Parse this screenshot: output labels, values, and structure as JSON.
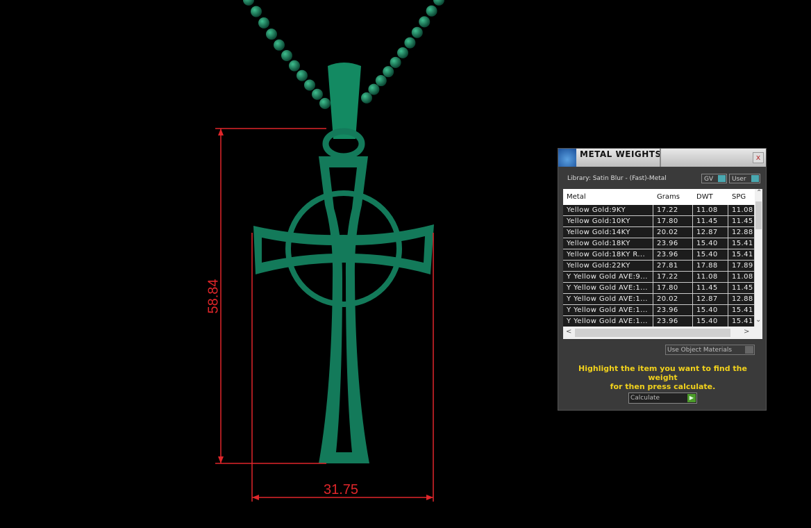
{
  "dimensions": {
    "height": "58.84",
    "width": "31.75"
  },
  "panel": {
    "title": "METAL WEIGHTS",
    "close_label": "x",
    "library": "Library: Satin Blur - (Fast)-Metal",
    "toggle_gv": "GV",
    "toggle_user": "User",
    "columns": [
      "Metal",
      "Grams",
      "DWT",
      "SPG"
    ],
    "rows": [
      [
        "Yellow Gold:9KY",
        "17.22",
        "11.08",
        "11.08"
      ],
      [
        "Yellow Gold:10KY",
        "17.80",
        "11.45",
        "11.45"
      ],
      [
        "Yellow Gold:14KY",
        "20.02",
        "12.87",
        "12.88"
      ],
      [
        "Yellow Gold:18KY",
        "23.96",
        "15.40",
        "15.41"
      ],
      [
        "Yellow Gold:18KY R...",
        "23.96",
        "15.40",
        "15.41"
      ],
      [
        "Yellow Gold:22KY",
        "27.81",
        "17.88",
        "17.89"
      ],
      [
        "Y Yellow Gold AVE:9...",
        "17.22",
        "11.08",
        "11.08"
      ],
      [
        "Y Yellow Gold AVE:1...",
        "17.80",
        "11.45",
        "11.45"
      ],
      [
        "Y Yellow Gold AVE:1...",
        "20.02",
        "12.87",
        "12.88"
      ],
      [
        "Y Yellow Gold AVE:1...",
        "23.96",
        "15.40",
        "15.41"
      ],
      [
        "Y Yellow Gold AVE:1...",
        "23.96",
        "15.40",
        "15.41"
      ]
    ],
    "use_object_materials": "Use Object Materials",
    "hint_line1": "Highlight the item you want to find the weight",
    "hint_line2": "for then press calculate.",
    "calculate_label": "Calculate"
  },
  "colors": {
    "model": "#137a5a",
    "dimension": "#e0262a",
    "hint": "#f2d21c"
  }
}
